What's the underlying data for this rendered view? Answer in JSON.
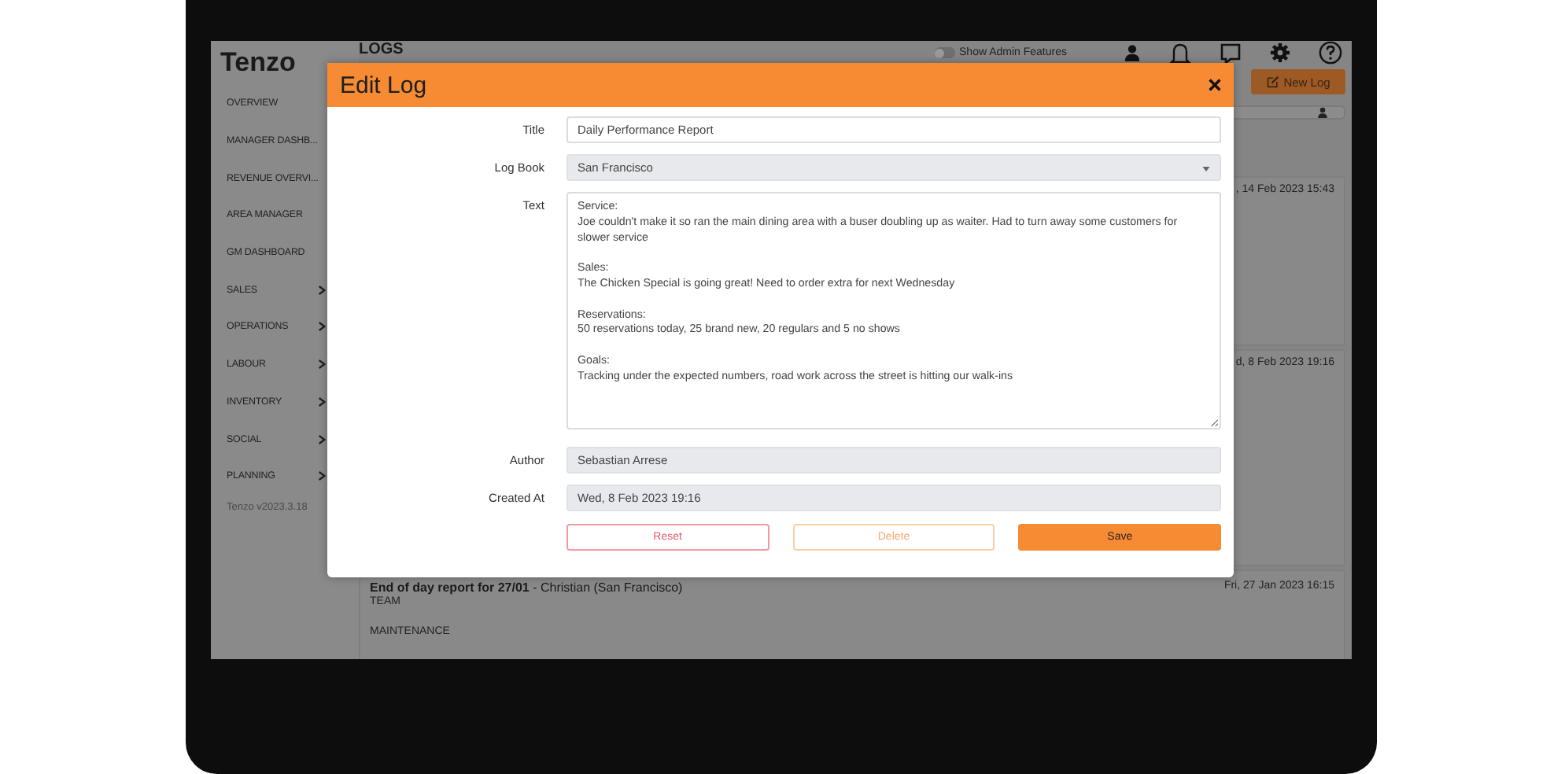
{
  "sidebar": {
    "logo": "Tenzo",
    "items": [
      {
        "label": "OVERVIEW",
        "has_submenu": false
      },
      {
        "label": "MANAGER DASHB...",
        "has_submenu": false
      },
      {
        "label": "REVENUE OVERVI...",
        "has_submenu": false
      },
      {
        "label": "AREA MANAGER",
        "has_submenu": false
      },
      {
        "label": "GM DASHBOARD",
        "has_submenu": false
      },
      {
        "label": "SALES",
        "has_submenu": true
      },
      {
        "label": "OPERATIONS",
        "has_submenu": true
      },
      {
        "label": "LABOUR",
        "has_submenu": true
      },
      {
        "label": "INVENTORY",
        "has_submenu": true
      },
      {
        "label": "SOCIAL",
        "has_submenu": true
      },
      {
        "label": "PLANNING",
        "has_submenu": true
      }
    ],
    "version": "Tenzo v2023.3.18"
  },
  "header": {
    "title": "LOGS",
    "admin_toggle": {
      "label": "Show Admin Features",
      "on": false
    },
    "new_log_button": "New Log"
  },
  "log_entries": [
    {
      "date": ", 14 Feb 2023 15:43"
    },
    {
      "date": "d, 8 Feb 2023 19:16"
    },
    {
      "title": "**End of day report for 27/01** - Christian (San Francisco)",
      "date": "Fri, 27 Jan 2023 16:15",
      "lines": [
        "TEAM",
        "MAINTENANCE"
      ]
    }
  ],
  "modal": {
    "title": "Edit Log",
    "fields": [
      {
        "label": "Title",
        "kind": "text",
        "value": "Daily Performance Report",
        "disabled": false
      },
      {
        "label": "Log Book",
        "kind": "select",
        "value": "San Francisco",
        "disabled": true
      },
      {
        "label": "Text",
        "kind": "textarea",
        "value": "Service:\nJoe couldn't make it so ran the main dining area with a buser doubling up as waiter. Had to turn away some customers for slower service\n\nSales:\nThe Chicken Special is going great! Need to order extra for next Wednesday\n\nReservations:\n50 reservations today, 25 brand new, 20 regulars and 5 no shows\n\nGoals:\nTracking under the expected numbers, road work across the street is hitting our walk-ins",
        "disabled": false
      },
      {
        "label": "Author",
        "kind": "text",
        "value": "Sebastian Arrese",
        "disabled": true
      },
      {
        "label": "Created At",
        "kind": "text",
        "value": "Wed, 8 Feb 2023 19:16",
        "disabled": true
      }
    ],
    "buttons": [
      {
        "label": "Reset",
        "kind": "danger"
      },
      {
        "label": "Delete",
        "kind": "warning"
      },
      {
        "label": "Save",
        "kind": "primary"
      }
    ]
  }
}
